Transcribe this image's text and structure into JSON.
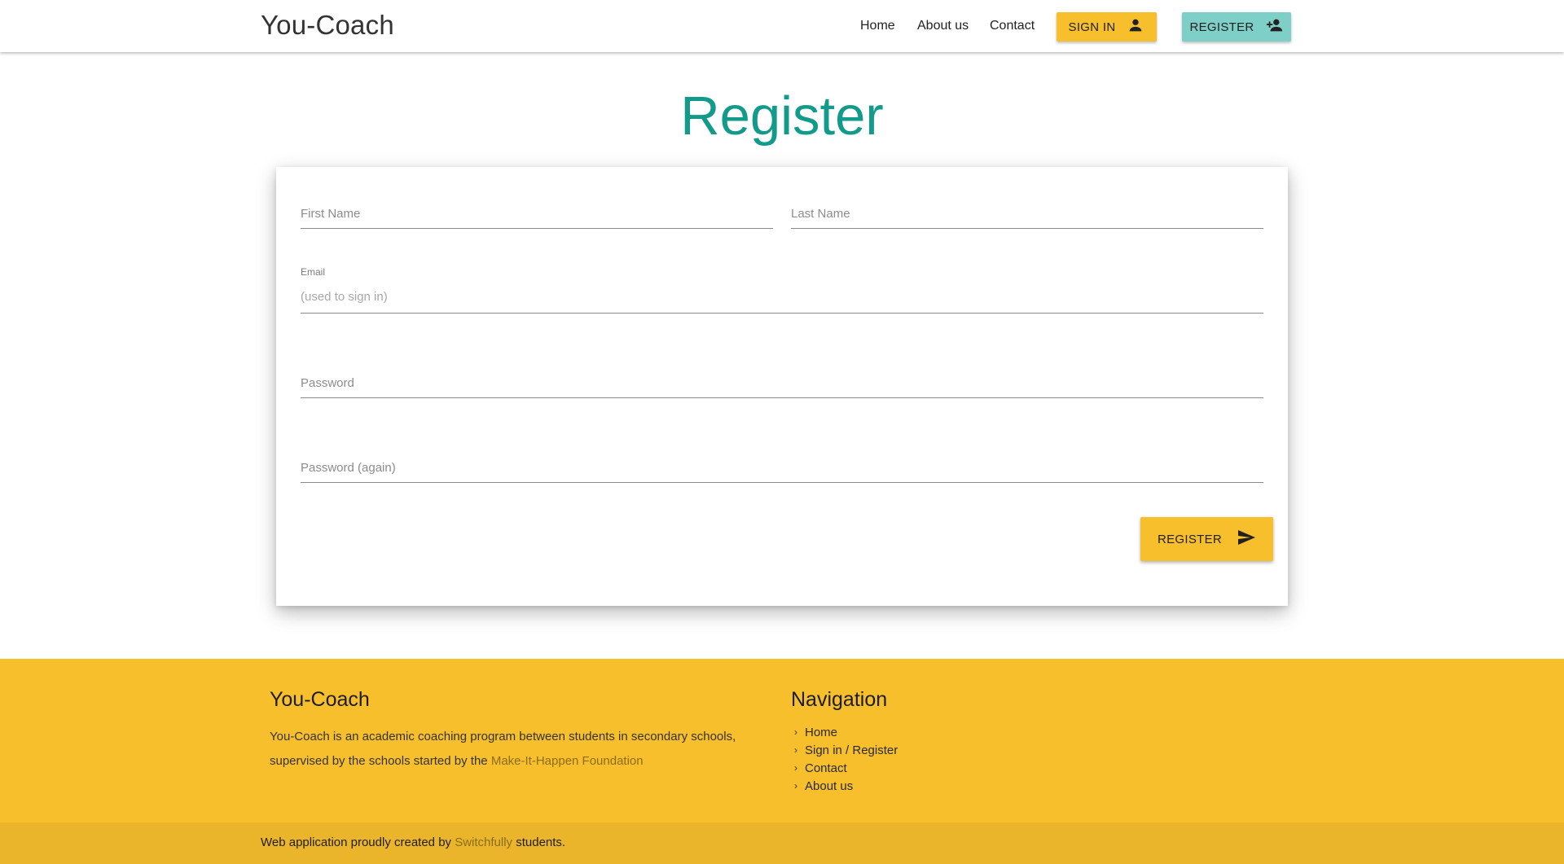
{
  "header": {
    "brand": "You-Coach",
    "nav": [
      {
        "label": "Home"
      },
      {
        "label": "About us"
      },
      {
        "label": "Contact"
      }
    ],
    "signin_label": "SIGN IN",
    "register_label": "REGISTER",
    "signin_icon": "person-icon",
    "register_icon": "person-add-icon",
    "signin_color": "#f8bf2d",
    "register_color": "#7ecfc7"
  },
  "page": {
    "title": "Register",
    "title_color": "#129b8a"
  },
  "form": {
    "first_name_placeholder": "First Name",
    "last_name_placeholder": "Last Name",
    "email_label": "Email",
    "email_placeholder": "(used to sign in)",
    "password_placeholder": "Password",
    "password_again_placeholder": "Password (again)",
    "submit_label": "REGISTER",
    "submit_icon": "send-icon"
  },
  "footer": {
    "about_title": "You-Coach",
    "about_text": "You-Coach is an academic coaching program between students in secondary schools, supervised by the schools started by the ",
    "about_link": "Make-It-Happen Foundation",
    "nav_title": "Navigation",
    "nav_items": [
      {
        "label": "Home"
      },
      {
        "label": "Sign in / Register"
      },
      {
        "label": "Contact"
      },
      {
        "label": "About us"
      }
    ],
    "credit_prefix": "Web application proudly created by ",
    "credit_link": "Switchfully",
    "credit_suffix": " students.",
    "bg_color": "#f8bf2d"
  }
}
